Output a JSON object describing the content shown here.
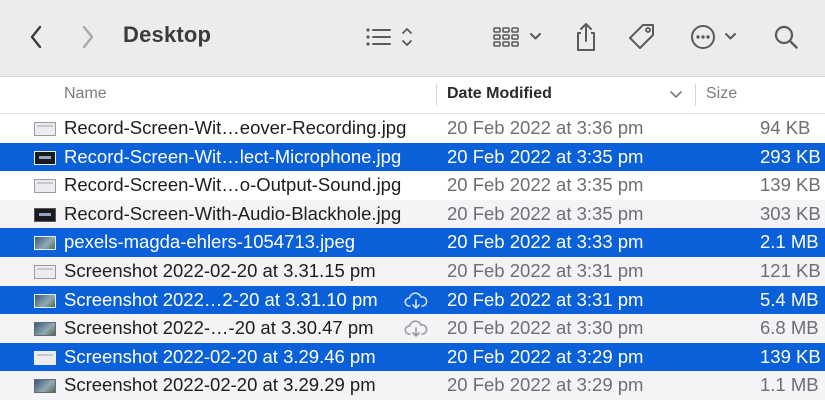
{
  "toolbar": {
    "title": "Desktop",
    "buttons": {
      "back": "chevron-left-icon",
      "forward": "chevron-right-icon",
      "view_options": "list-view-icon",
      "group": "grid-view-icon",
      "share": "share-icon",
      "tags": "tag-icon",
      "more": "ellipsis-circle-icon",
      "search": "search-icon"
    }
  },
  "columns": {
    "name": "Name",
    "date_modified": "Date Modified",
    "size": "Size"
  },
  "colors": {
    "selection": "#0a60d8",
    "alt_row": "#f4f4f6"
  },
  "files": [
    {
      "name": "Record-Screen-Wit…eover-Recording.jpg",
      "date": "20 Feb 2022 at 3:36 pm",
      "size": "94 KB",
      "selected": false,
      "thumb": "light",
      "cloud": false
    },
    {
      "name": "Record-Screen-Wit…lect-Microphone.jpg",
      "date": "20 Feb 2022 at 3:35 pm",
      "size": "293 KB",
      "selected": true,
      "thumb": "dark",
      "cloud": false
    },
    {
      "name": "Record-Screen-Wit…o-Output-Sound.jpg",
      "date": "20 Feb 2022 at 3:35 pm",
      "size": "139 KB",
      "selected": false,
      "thumb": "light",
      "cloud": false
    },
    {
      "name": "Record-Screen-With-Audio-Blackhole.jpg",
      "date": "20 Feb 2022 at 3:35 pm",
      "size": "303 KB",
      "selected": false,
      "thumb": "dark",
      "cloud": false
    },
    {
      "name": "pexels-magda-ehlers-1054713.jpeg",
      "date": "20 Feb 2022 at 3:33 pm",
      "size": "2.1 MB",
      "selected": true,
      "thumb": "photo",
      "cloud": false
    },
    {
      "name": "Screenshot 2022-02-20 at 3.31.15 pm",
      "date": "20 Feb 2022 at 3:31 pm",
      "size": "121 KB",
      "selected": false,
      "thumb": "light",
      "cloud": false
    },
    {
      "name": "Screenshot 2022…2-20 at 3.31.10 pm",
      "date": "20 Feb 2022 at 3:31 pm",
      "size": "5.4 MB",
      "selected": true,
      "thumb": "photo",
      "cloud": true
    },
    {
      "name": "Screenshot 2022-…-20 at 3.30.47 pm",
      "date": "20 Feb 2022 at 3:30 pm",
      "size": "6.8 MB",
      "selected": false,
      "thumb": "photo",
      "cloud": true
    },
    {
      "name": "Screenshot 2022-02-20 at 3.29.46 pm",
      "date": "20 Feb 2022 at 3:29 pm",
      "size": "139 KB",
      "selected": true,
      "thumb": "light",
      "cloud": false
    },
    {
      "name": "Screenshot 2022-02-20 at 3.29.29 pm",
      "date": "20 Feb 2022 at 3:29 pm",
      "size": "1.1 MB",
      "selected": false,
      "thumb": "photo",
      "cloud": false
    }
  ]
}
